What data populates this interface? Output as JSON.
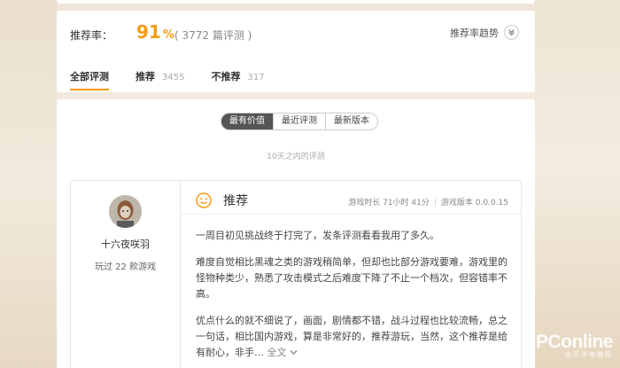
{
  "summary": {
    "rating_label": "推荐率：",
    "rating_value": "91",
    "rating_unit": "%",
    "review_count_text": "( 3772 篇评测 )",
    "trend_label": "推荐率趋势",
    "trend_icon": "chevron-double-down-icon"
  },
  "tabs": [
    {
      "label": "全部评测",
      "count": ""
    },
    {
      "label": "推荐",
      "count": "3455"
    },
    {
      "label": "不推荐",
      "count": "317"
    }
  ],
  "sort": {
    "options": [
      "最有价值",
      "最近评测",
      "最新版本"
    ],
    "active_index": 0
  },
  "time_note": "10天之内的评测",
  "review": {
    "username": "十六夜咲羽",
    "played": "玩过 22 款游戏",
    "verdict": "推荐",
    "verdict_icon": "smile-face-icon",
    "playtime": "游戏时长 71小时 41分",
    "separator": "|",
    "version": "游戏版本 0.0.0.15",
    "paragraphs": [
      "一周目初见挑战终于打完了，发条评测看看我用了多久。",
      "难度自觉相比黑魂之类的游戏稍简单，但却也比部分游戏要难，游戏里的怪物种类少，熟悉了攻击模式之后难度下降了不止一个档次，但容错率不高。",
      "优点什么的就不细说了，画面，剧情都不错，战斗过程也比较流畅，总之一句话，相比国内游戏，算是非常好的，推荐游玩，当然，这个推荐是给有耐心，非手…"
    ],
    "more_label": "全文"
  },
  "watermark": {
    "main": "PConline",
    "sub": "太平洋电脑网"
  },
  "colors": {
    "accent": "#f39c12",
    "active_segment": "#555555"
  }
}
